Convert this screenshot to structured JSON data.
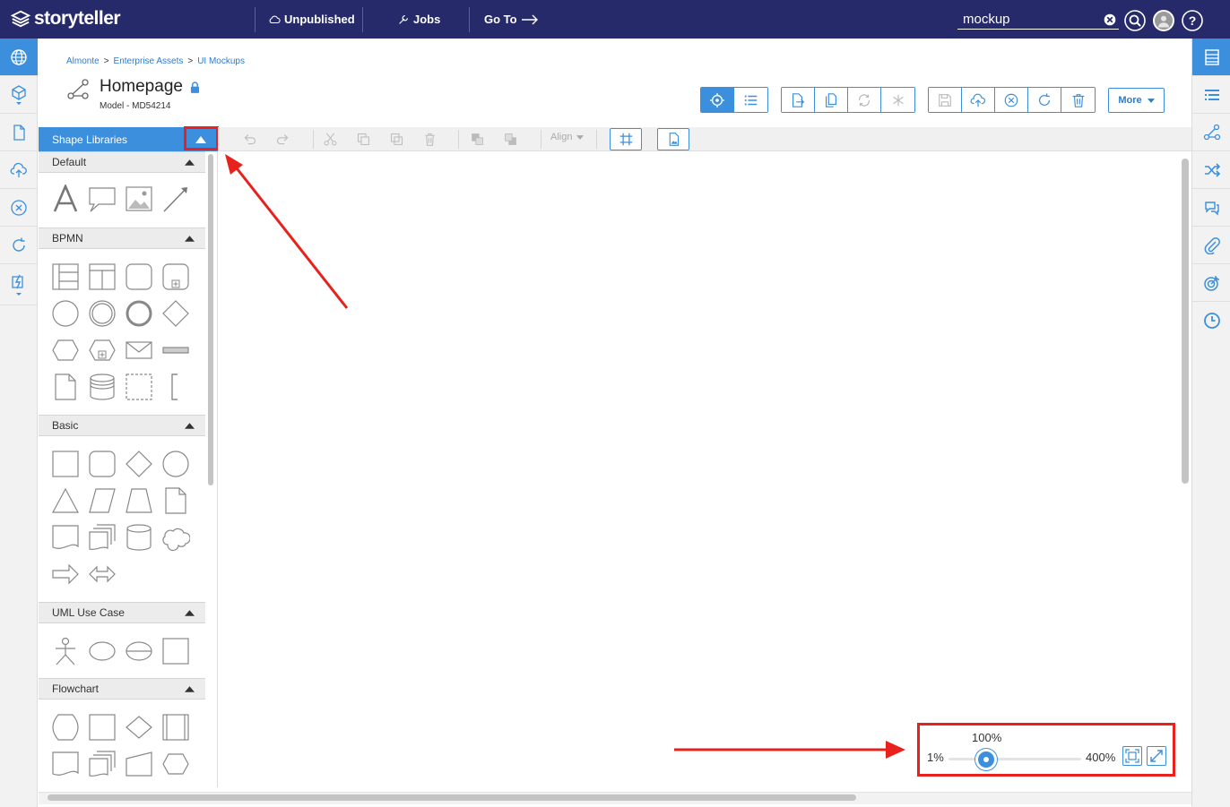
{
  "app": {
    "logo_text": "storyteller"
  },
  "topbar": {
    "unpublished_label": "Unpublished",
    "jobs_label": "Jobs",
    "goto_label": "Go To",
    "search_value": "mockup"
  },
  "breadcrumb": {
    "items": [
      "Almonte",
      "Enterprise Assets",
      "UI Mockups"
    ],
    "separator": ">"
  },
  "page": {
    "title": "Homepage",
    "model_id": "Model - MD54214"
  },
  "toolbar": {
    "more_label": "More"
  },
  "shape_library": {
    "title": "Shape Libraries",
    "sections": [
      {
        "name": "Default"
      },
      {
        "name": "BPMN"
      },
      {
        "name": "Basic"
      },
      {
        "name": "UML Use Case"
      },
      {
        "name": "Flowchart"
      }
    ]
  },
  "editor_toolbar": {
    "align_label": "Align"
  },
  "zoom": {
    "value_label": "100%",
    "min_label": "1%",
    "max_label": "400%",
    "level_percent": 100
  },
  "colors": {
    "nav_bg": "#26296a",
    "accent": "#3c8fdc",
    "annotation_red": "#e8211c"
  }
}
